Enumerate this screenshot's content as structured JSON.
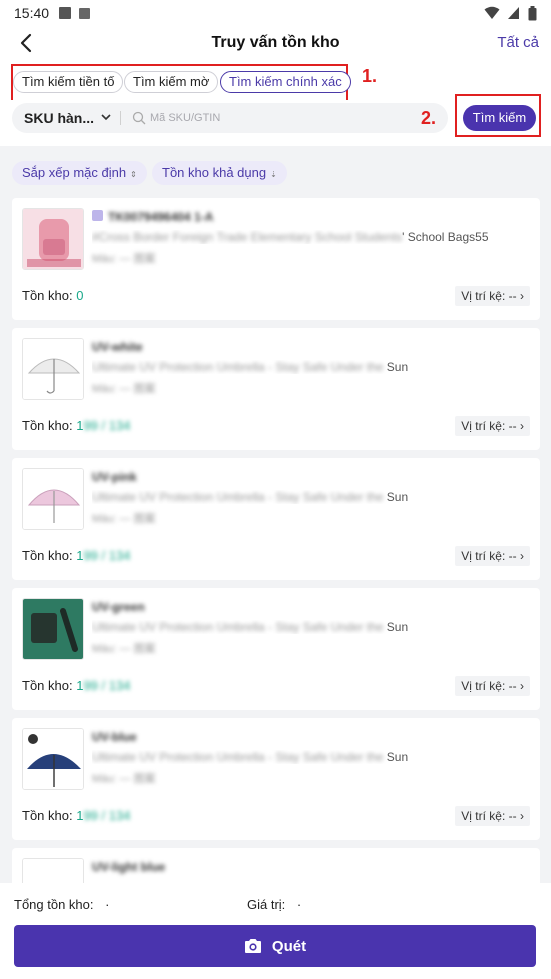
{
  "status_bar": {
    "time": "15:40"
  },
  "header": {
    "title": "Truy vấn tồn kho",
    "right_action": "Tất cả"
  },
  "search_modes": {
    "marker": "1.",
    "items": [
      "Tìm kiếm tiền tố",
      "Tìm kiếm mờ",
      "Tìm kiếm chính xác"
    ],
    "active": "Tìm kiếm chính xác"
  },
  "search": {
    "field_select": "SKU hàn...",
    "placeholder": "Mã SKU/GTIN",
    "marker": "2.",
    "button": "Tìm kiếm"
  },
  "sort": {
    "default": "Sắp xếp mặc định",
    "available": "Tồn kho khả dụng"
  },
  "products": [
    {
      "code": "TK0079496404 1-A",
      "title_blur": "#Cross Border Foreign Trade Elementary School Students",
      "title_clear": "' School Bags55",
      "attr": "Màu: — 图案",
      "stock_label": "Tồn kho:",
      "stock_clear": "0",
      "stock_blur": "",
      "location": "Vị trí kệ:",
      "location_value": "--"
    },
    {
      "code": "UV-white",
      "title_blur": "Ultimate UV Protection Umbrella - Stay Safe Under the",
      "title_clear": " Sun",
      "attr": "Màu: — 图案",
      "stock_label": "Tồn kho:",
      "stock_clear": "1",
      "stock_blur": "99 / 134",
      "location": "Vị trí kệ:",
      "location_value": "--"
    },
    {
      "code": "UV-pink",
      "title_blur": "Ultimate UV Protection Umbrella - Stay Safe Under the",
      "title_clear": " Sun",
      "attr": "Màu: — 图案",
      "stock_label": "Tồn kho:",
      "stock_clear": "1",
      "stock_blur": "99 / 134",
      "location": "Vị trí kệ:",
      "location_value": "--"
    },
    {
      "code": "UV-green",
      "title_blur": "Ultimate UV Protection Umbrella - Stay Safe Under the",
      "title_clear": " Sun",
      "attr": "Màu: — 图案",
      "stock_label": "Tồn kho:",
      "stock_clear": "1",
      "stock_blur": "99 / 134",
      "location": "Vị trí kệ:",
      "location_value": "--"
    },
    {
      "code": "UV-blue",
      "title_blur": "Ultimate UV Protection Umbrella - Stay Safe Under the",
      "title_clear": " Sun",
      "attr": "Màu: — 图案",
      "stock_label": "Tồn kho:",
      "stock_clear": "1",
      "stock_blur": "99 / 134",
      "location": "Vị trí kệ:",
      "location_value": "--"
    },
    {
      "code": "UV-light blue",
      "title_blur": "",
      "title_clear": "",
      "attr": "",
      "stock_label": "",
      "stock_clear": "",
      "stock_blur": "",
      "location": "",
      "location_value": ""
    }
  ],
  "footer": {
    "total_label": "Tổng tồn kho:",
    "total_value": "·",
    "value_label": "Giá trị:",
    "value_value": "·",
    "scan_button": "Quét"
  },
  "colors": {
    "accent": "#4a34ae",
    "annotation": "#e02020",
    "stock": "#1aa88a"
  }
}
